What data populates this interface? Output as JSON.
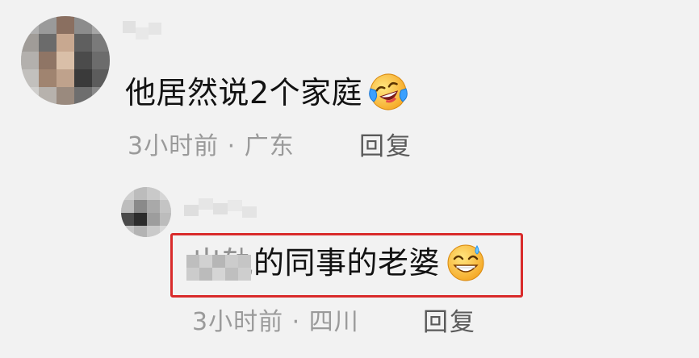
{
  "comment": {
    "text": "他居然说2个家庭",
    "emoji": "laughing-crying-emoji",
    "time": "3小时前",
    "separator": "·",
    "location": "广东",
    "reply_label": "回复"
  },
  "reply": {
    "text_blurred": "出轨",
    "text_rest": "的同事的老婆",
    "emoji": "sweat-smile-emoji",
    "time": "3小时前",
    "separator": "·",
    "location": "四川",
    "reply_label": "回复"
  },
  "colors": {
    "highlight_border": "#d92b2b",
    "meta_text": "#9a9a9a",
    "reply_link": "#5a5a5a"
  }
}
